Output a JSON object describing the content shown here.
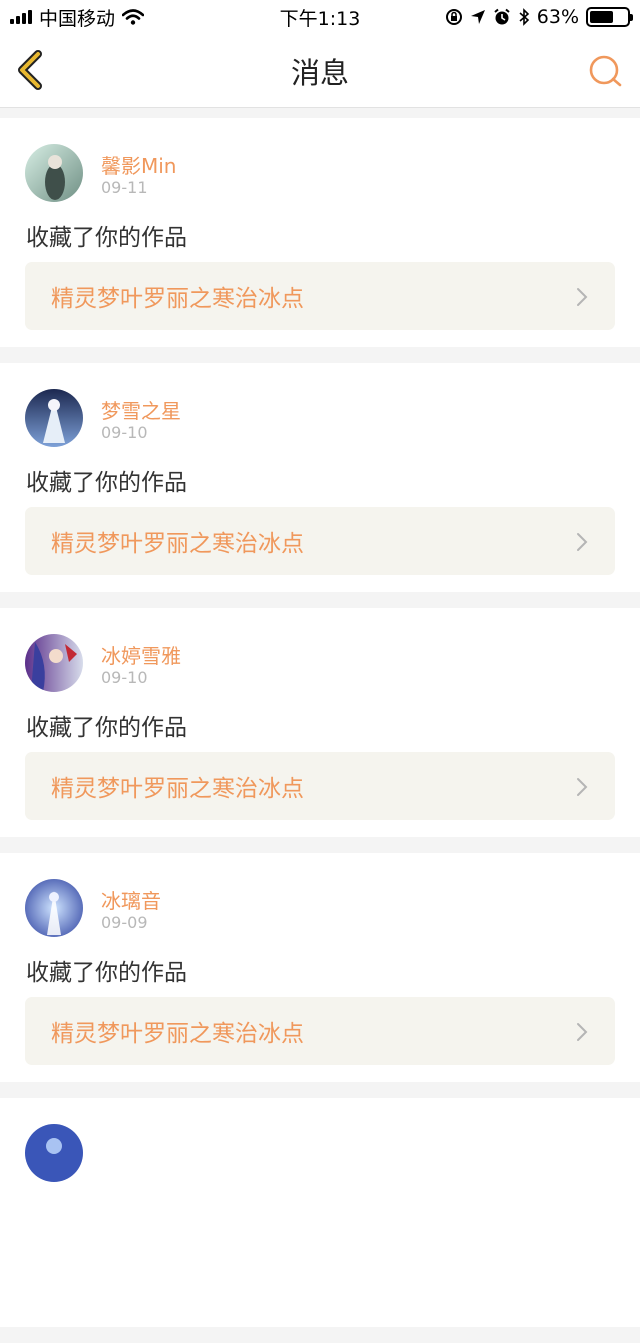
{
  "status_bar": {
    "carrier": "中国移动",
    "time": "下午1:13",
    "battery": "63%",
    "battery_level": 0.63
  },
  "nav": {
    "title": "消息",
    "back_icon": "chevron-left-icon",
    "search_icon": "search-icon"
  },
  "colors": {
    "accent": "#f0985c",
    "back_icon": "#e8b830",
    "card_link_bg": "#f5f4ee"
  },
  "messages": [
    {
      "username": "馨影Min",
      "date": "09-11",
      "action": "收藏了你的作品",
      "work_title": "精灵梦叶罗丽之寒治冰点"
    },
    {
      "username": "梦雪之星",
      "date": "09-10",
      "action": "收藏了你的作品",
      "work_title": "精灵梦叶罗丽之寒治冰点"
    },
    {
      "username": "冰婷雪雅",
      "date": "09-10",
      "action": "收藏了你的作品",
      "work_title": "精灵梦叶罗丽之寒治冰点"
    },
    {
      "username": "冰璃音",
      "date": "09-09",
      "action": "收藏了你的作品",
      "work_title": "精灵梦叶罗丽之寒治冰点"
    }
  ]
}
